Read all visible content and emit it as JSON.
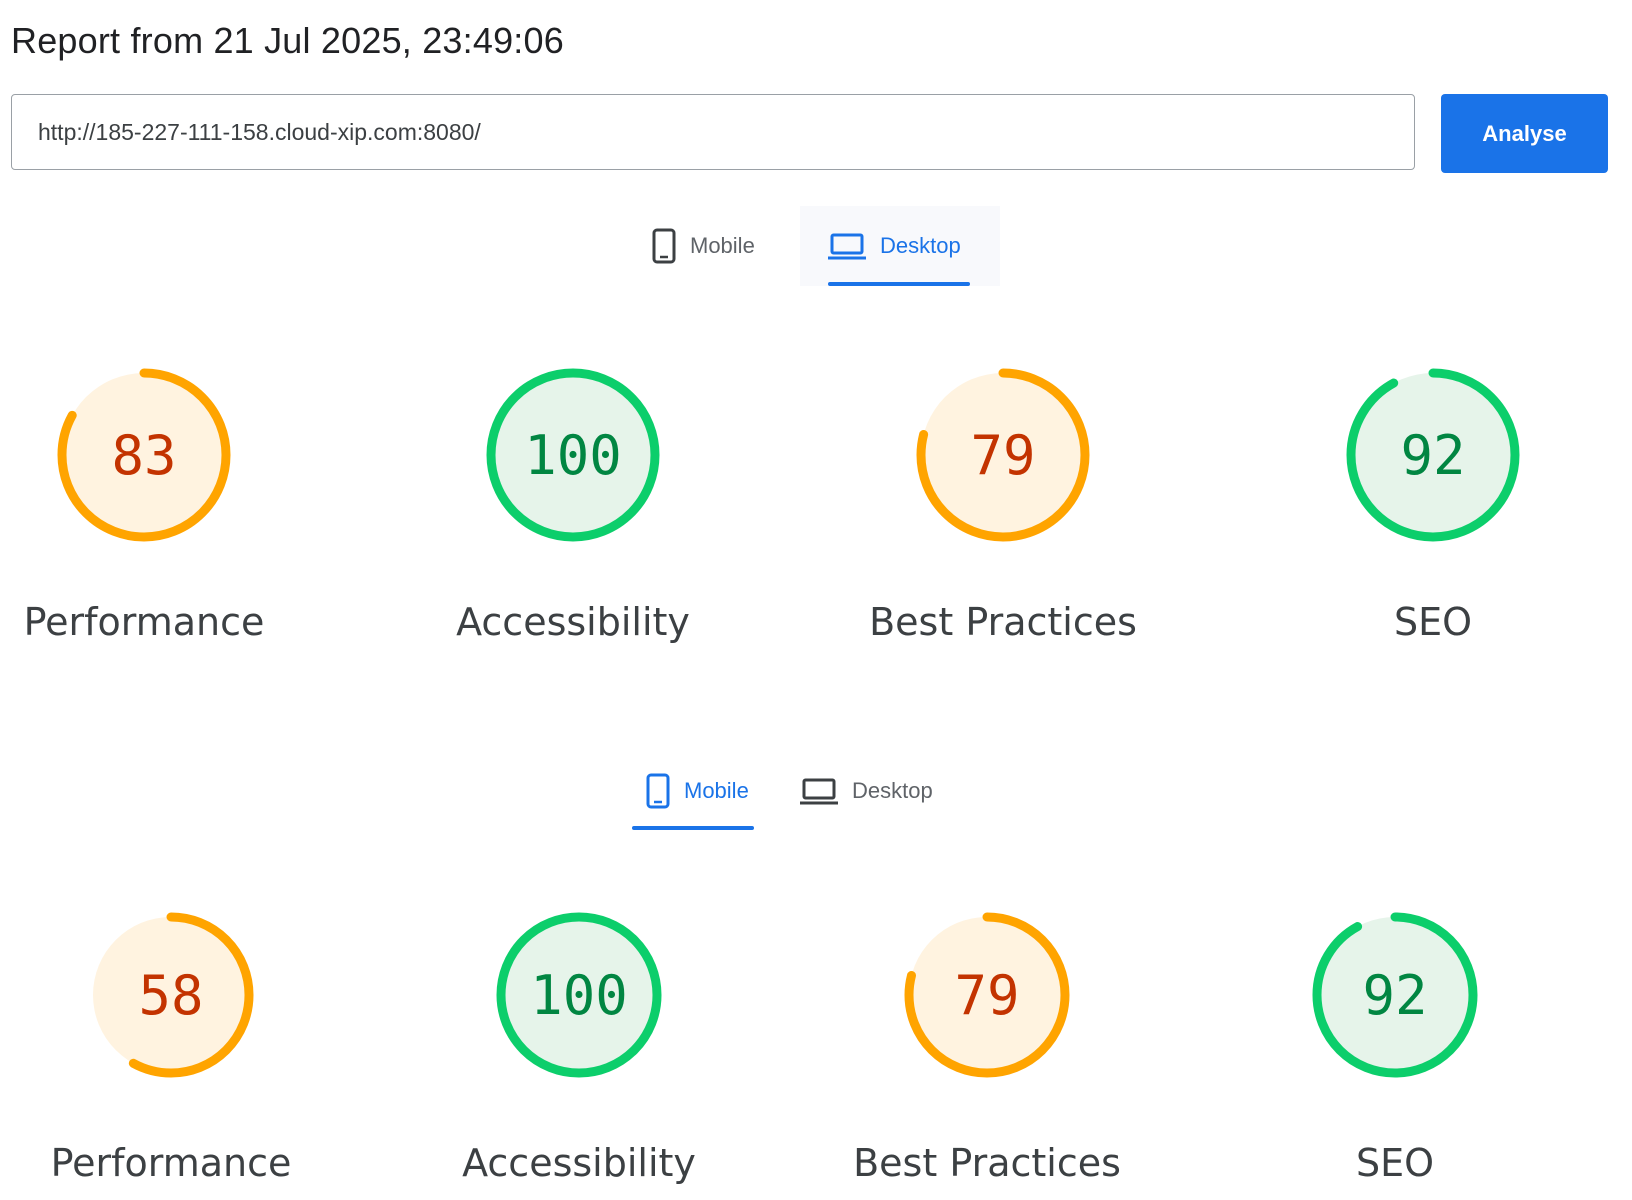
{
  "report": {
    "title": "Report from 21 Jul 2025, 23:49:06",
    "url_value": "http://185-227-111-158.cloud-xip.com:8080/",
    "analyse_label": "Analyse"
  },
  "colors": {
    "accent": "#1a73e8",
    "average_ring": "#ffa400",
    "average_text": "#c33300",
    "average_fill": "#fff3e0",
    "pass_ring": "#0cce6b",
    "pass_text": "#018642",
    "pass_fill": "#e6f4ea"
  },
  "sections": [
    {
      "tabs": [
        {
          "label": "Mobile",
          "icon": "phone-icon",
          "active": false
        },
        {
          "label": "Desktop",
          "icon": "laptop-icon",
          "active": true
        }
      ],
      "scores": [
        {
          "label": "Performance",
          "score": 83,
          "rating": "average"
        },
        {
          "label": "Accessibility",
          "score": 100,
          "rating": "pass"
        },
        {
          "label": "Best Practices",
          "score": 79,
          "rating": "average"
        },
        {
          "label": "SEO",
          "score": 92,
          "rating": "pass"
        }
      ]
    },
    {
      "tabs": [
        {
          "label": "Mobile",
          "icon": "phone-icon",
          "active": true
        },
        {
          "label": "Desktop",
          "icon": "laptop-icon",
          "active": false
        }
      ],
      "scores": [
        {
          "label": "Performance",
          "score": 58,
          "rating": "average"
        },
        {
          "label": "Accessibility",
          "score": 100,
          "rating": "pass"
        },
        {
          "label": "Best Practices",
          "score": 79,
          "rating": "average"
        },
        {
          "label": "SEO",
          "score": 92,
          "rating": "pass"
        }
      ]
    }
  ]
}
